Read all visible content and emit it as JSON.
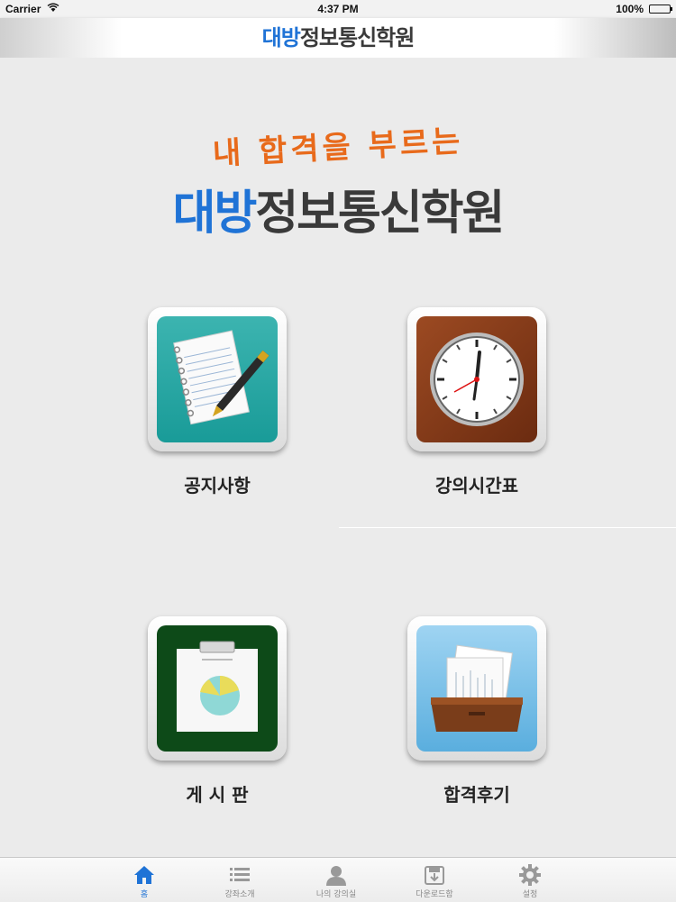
{
  "status": {
    "carrier": "Carrier",
    "time": "4:37 PM",
    "battery": "100%"
  },
  "nav": {
    "title_blue": "대방",
    "title_dark": "정보통신학원"
  },
  "hero": {
    "slogan": "내 합격을 부르는",
    "brand_blue": "대방",
    "brand_dark": "정보통신학원"
  },
  "tiles": [
    {
      "label": "공지사항",
      "icon": "notepad-pen-icon",
      "color": "#2aa9a5"
    },
    {
      "label": "강의시간표",
      "icon": "clock-icon",
      "color": "#8a3d1a"
    },
    {
      "label": "게 시 판",
      "icon": "clipboard-chart-icon",
      "color": "#0d4a18"
    },
    {
      "label": "합격후기",
      "icon": "document-tray-icon",
      "color": "#7cc2ea"
    }
  ],
  "tabbar": [
    {
      "label": "홈",
      "icon": "home-icon",
      "active": true
    },
    {
      "label": "강좌소개",
      "icon": "list-icon",
      "active": false
    },
    {
      "label": "나의 강의실",
      "icon": "person-icon",
      "active": false
    },
    {
      "label": "다운로드함",
      "icon": "download-icon",
      "active": false
    },
    {
      "label": "설정",
      "icon": "gear-icon",
      "active": false
    }
  ],
  "colors": {
    "accent": "#1f73d6",
    "slogan": "#e86a1b",
    "text": "#3a3a3a"
  }
}
